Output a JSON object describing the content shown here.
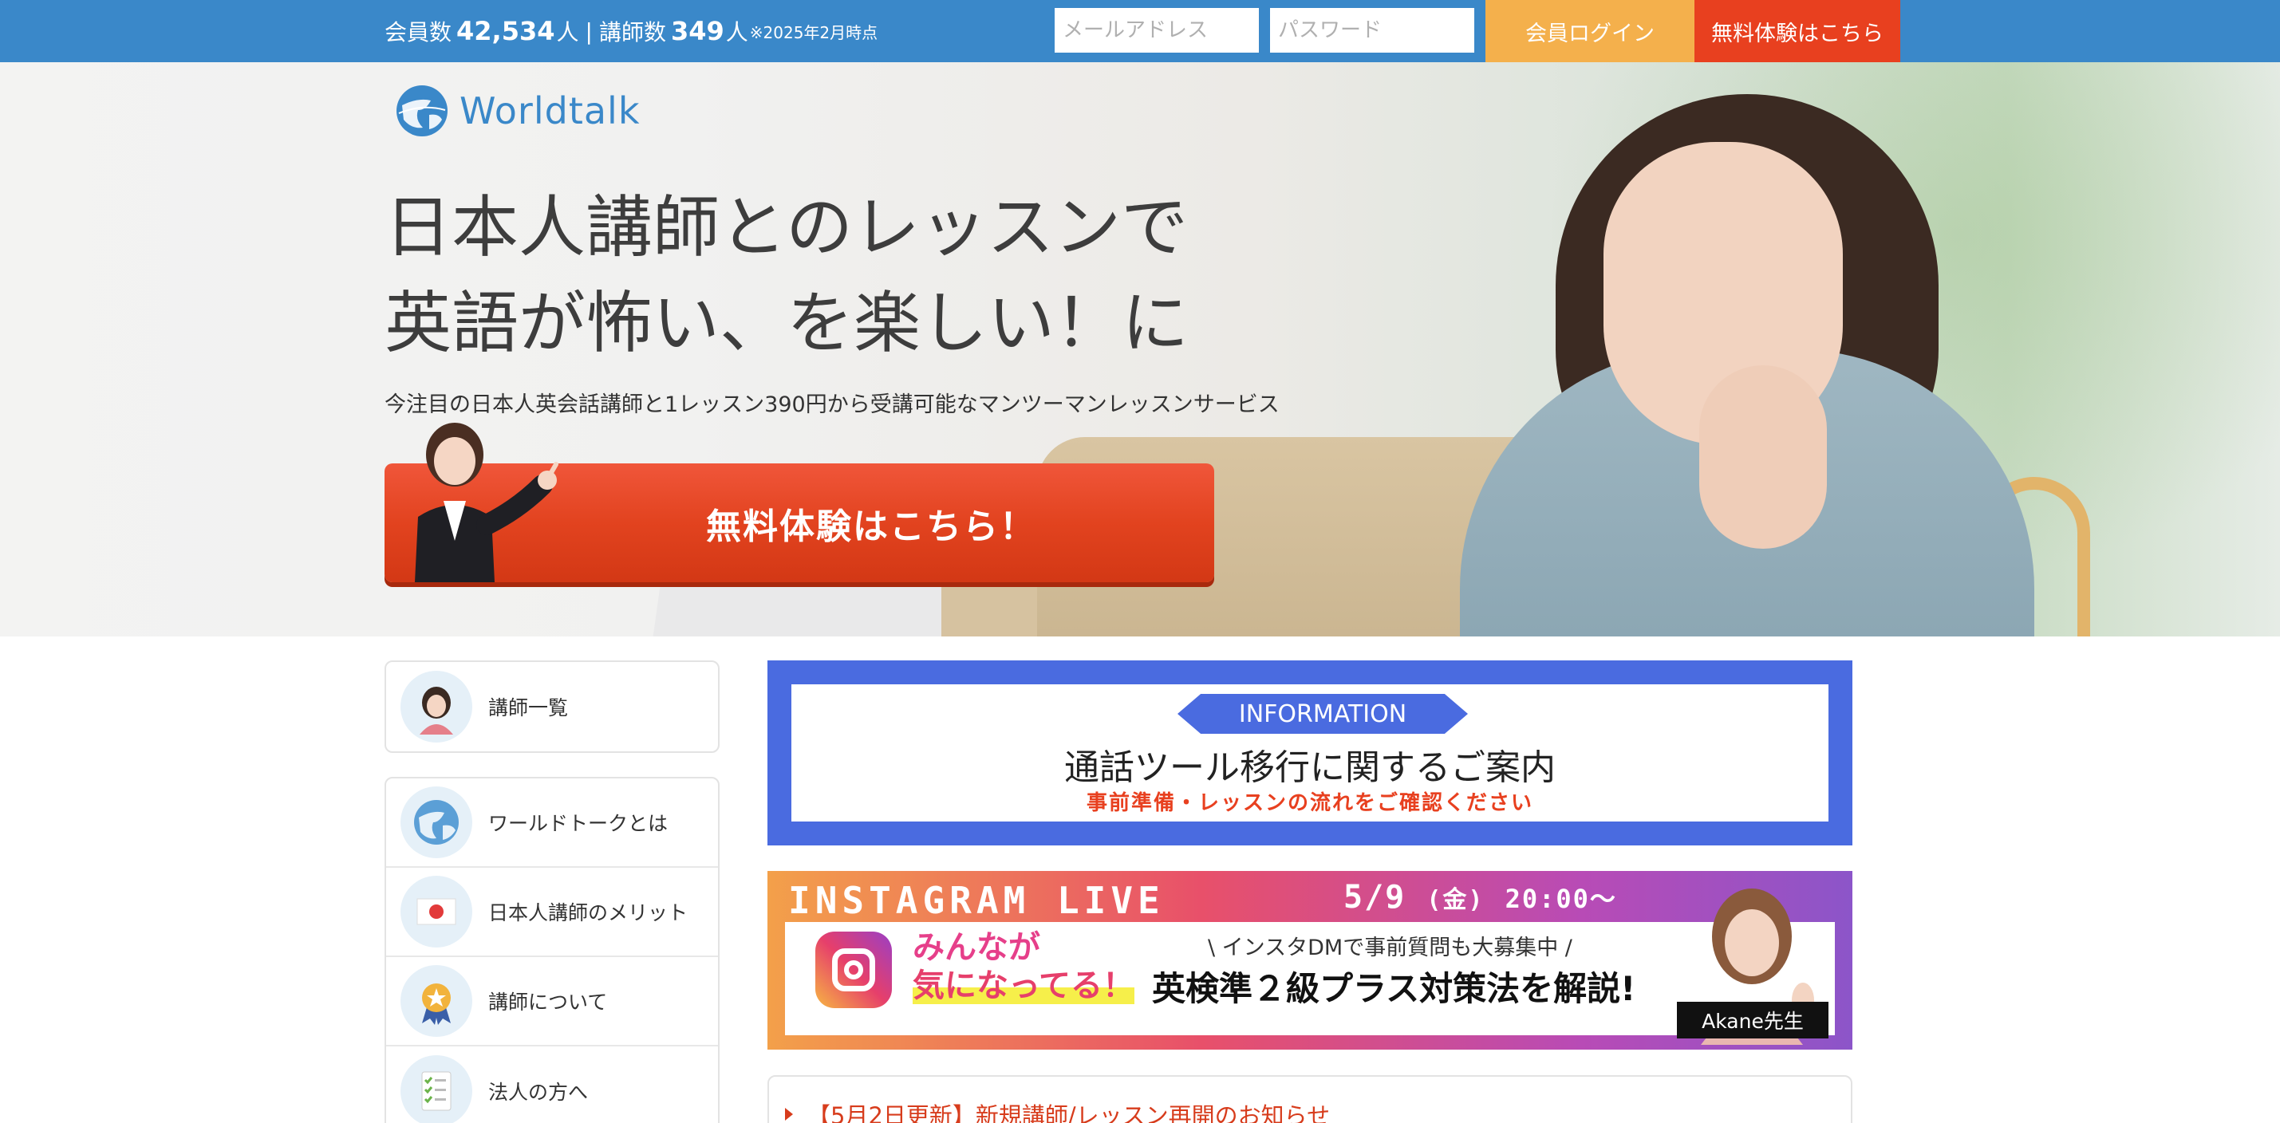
{
  "topbar": {
    "members_label": "会員数",
    "members_count": "42,534",
    "members_unit": "人",
    "separator": "|",
    "teachers_label": "講師数",
    "teachers_count": "349",
    "teachers_unit": "人",
    "as_of_note": "※2025年2月時点",
    "email_placeholder": "メールアドレス",
    "password_placeholder": "パスワード",
    "login_label": "会員ログイン",
    "trial_label": "無料体験はこちら"
  },
  "colors": {
    "topbar_bg": "#3a88c9",
    "login_btn": "#f4b04c",
    "trial_btn": "#e8401f",
    "info_banner": "#4a6be0",
    "accent_red": "#d73c1c"
  },
  "hero": {
    "logo_text": "Worldtalk",
    "title_line1": "日本人講師とのレッスンで",
    "title_line2": "英語が怖い、を楽しい！に",
    "subtitle": "今注目の日本人英会話講師と1レッスン390円から受講可能なマンツーマンレッスンサービス",
    "cta_label": "無料体験はこちら！"
  },
  "sidebar": {
    "teachers_item": {
      "label": "講師一覧",
      "icon": "teacher-avatar-icon"
    },
    "items": [
      {
        "label": "ワールドトークとは",
        "icon": "globe-icon"
      },
      {
        "label": "日本人講師のメリット",
        "icon": "japan-flag-icon"
      },
      {
        "label": "講師について",
        "icon": "award-medal-icon"
      },
      {
        "label": "法人の方へ",
        "icon": "checklist-icon"
      }
    ]
  },
  "info_banner": {
    "tag": "INFORMATION",
    "title": "通話ツール移行に関するご案内",
    "subtitle": "事前準備・レッスンの流れをご確認ください"
  },
  "instagram_banner": {
    "title": "INSTAGRAM LIVE",
    "date": "5/9",
    "weekday": "(金)",
    "time": "20:00〜",
    "catch_line1": "みんなが",
    "catch_line2": "気になってる！",
    "note": "\\ インスタDMで事前質問も大募集中 /",
    "main_text": "英検準２級プラス対策法を解説!",
    "host_name": "Akane先生"
  },
  "news": {
    "items": [
      {
        "label": "【5月2日更新】新規講師/レッスン再開のお知らせ"
      }
    ]
  }
}
